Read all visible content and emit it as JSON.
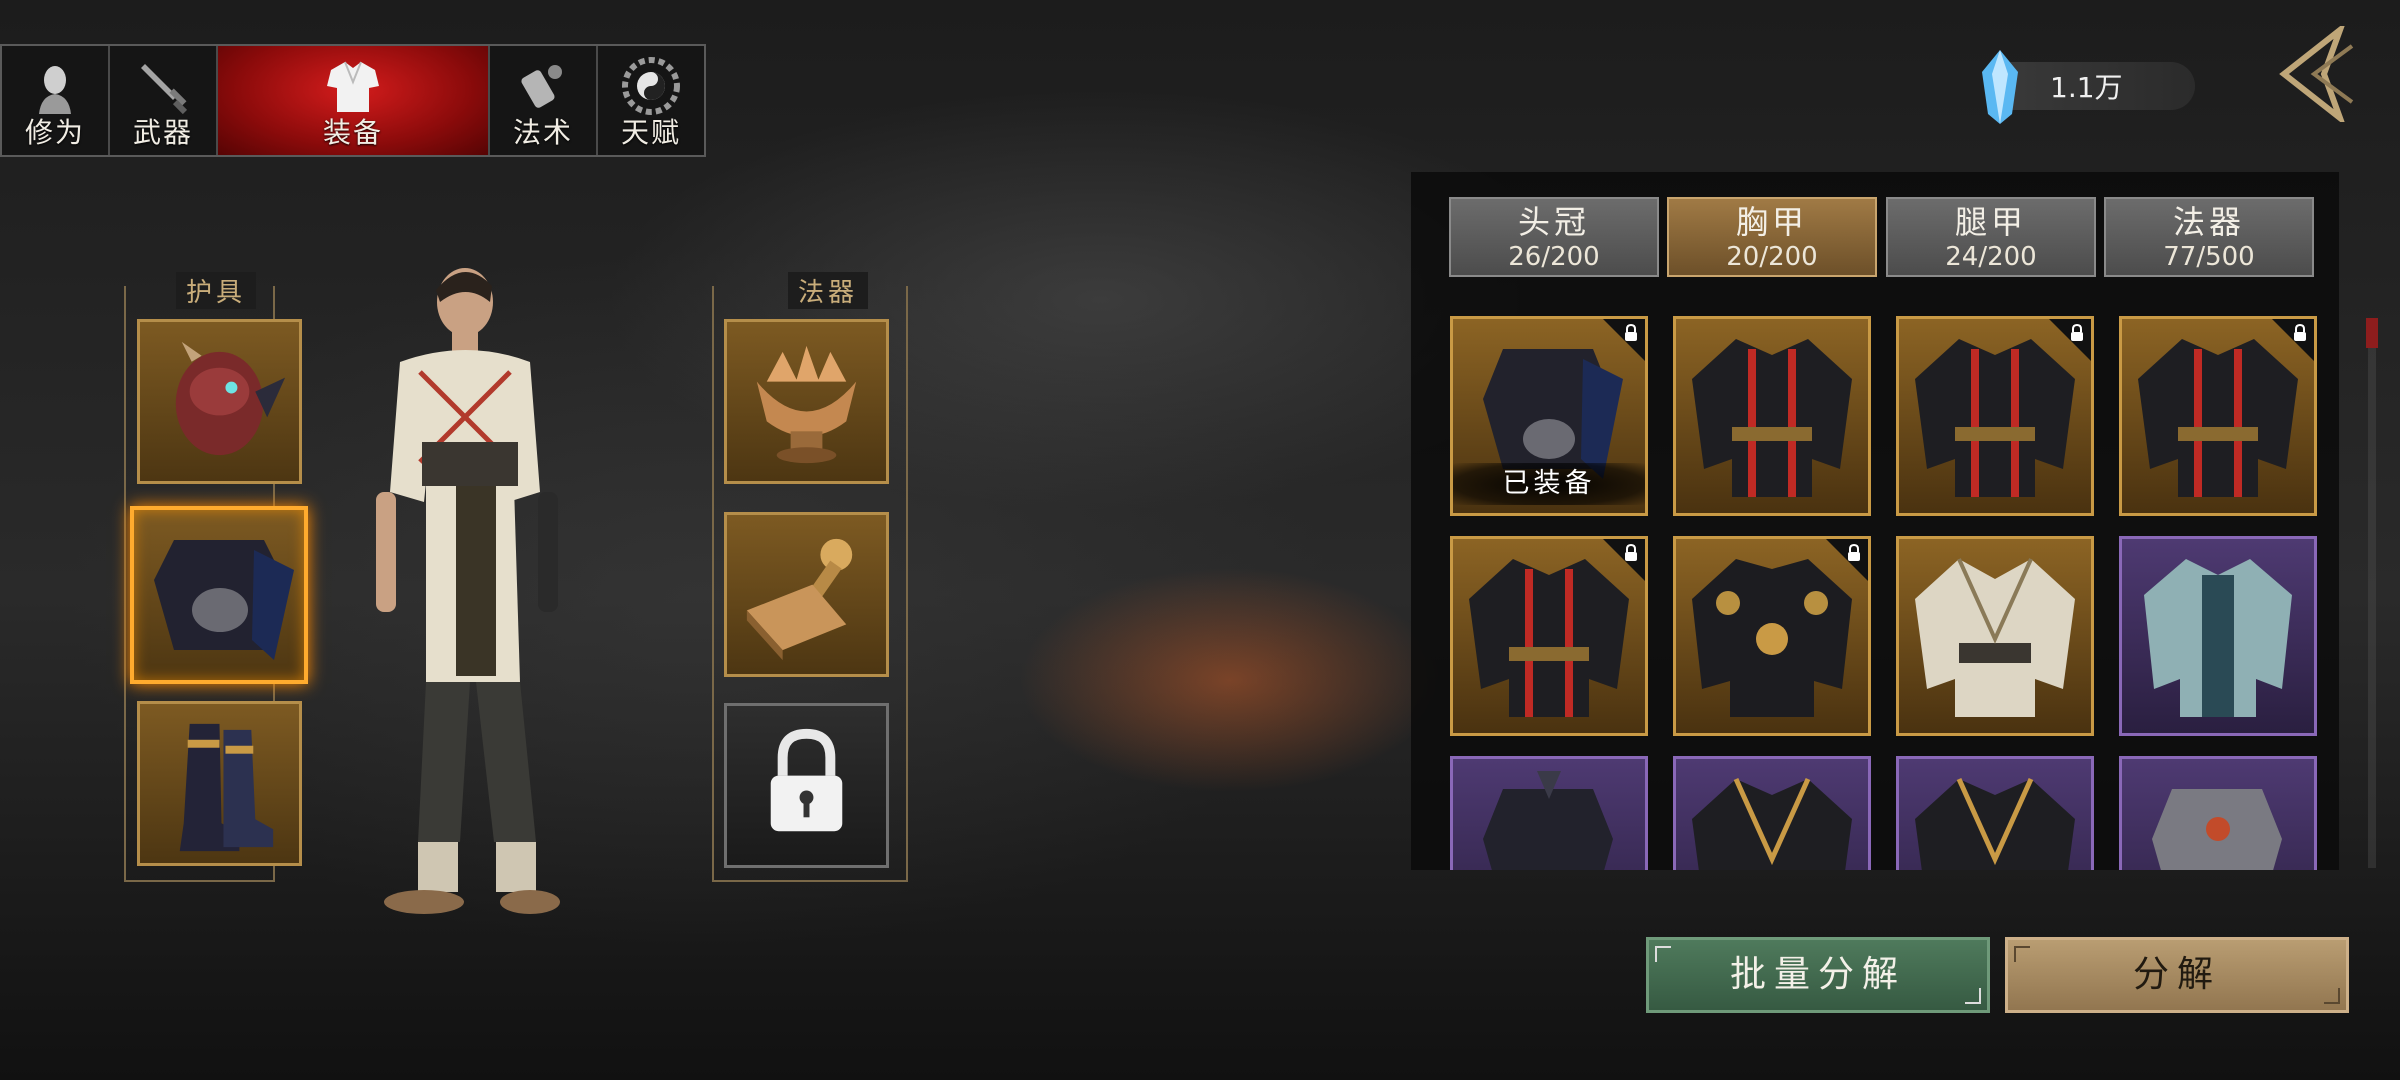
{
  "top_tabs": [
    {
      "label": "修为",
      "icon": "cultivator-head-icon"
    },
    {
      "label": "武器",
      "icon": "sword-hilt-icon"
    },
    {
      "label": "装备",
      "icon": "robe-icon",
      "active": true
    },
    {
      "label": "法术",
      "icon": "scroll-icon"
    },
    {
      "label": "天赋",
      "icon": "bagua-icon"
    }
  ],
  "currency": {
    "value": "1.1万",
    "icon": "blue-crystal-icon"
  },
  "left_groups": {
    "armor_title": "护具",
    "artifact_title": "法器"
  },
  "category_tabs": [
    {
      "name": "头冠",
      "count": "26/200"
    },
    {
      "name": "胸甲",
      "count": "20/200",
      "active": true
    },
    {
      "name": "腿甲",
      "count": "24/200"
    },
    {
      "name": "法器",
      "count": "77/500"
    }
  ],
  "items": [
    {
      "rarity": "gold",
      "locked": true,
      "equipped": true,
      "equipped_label": "已装备",
      "icon": "dark-armor-icon"
    },
    {
      "rarity": "gold",
      "locked": false,
      "icon": "black-red-robe-icon"
    },
    {
      "rarity": "gold",
      "locked": true,
      "icon": "black-red-robe-icon"
    },
    {
      "rarity": "gold",
      "locked": true,
      "icon": "black-red-robe-icon"
    },
    {
      "rarity": "gold",
      "locked": true,
      "icon": "black-red-robe-icon"
    },
    {
      "rarity": "gold",
      "locked": true,
      "icon": "black-gold-jacket-icon"
    },
    {
      "rarity": "gold",
      "locked": false,
      "icon": "white-robe-icon"
    },
    {
      "rarity": "purple",
      "locked": false,
      "icon": "teal-robe-icon"
    },
    {
      "rarity": "purple",
      "locked": false,
      "icon": "dark-armor-icon"
    },
    {
      "rarity": "purple",
      "locked": false,
      "icon": "black-gold-robe-icon"
    },
    {
      "rarity": "purple",
      "locked": false,
      "icon": "black-gold-robe-icon"
    },
    {
      "rarity": "purple",
      "locked": false,
      "icon": "steel-armor-icon"
    }
  ],
  "buttons": {
    "batch_decompose": "批量分解",
    "decompose": "分解"
  },
  "colors": {
    "active_tab_red": "#c41414",
    "gold_rarity": "#c99a45",
    "purple_rarity": "#8a68b8",
    "selected_glow": "#ffab2e",
    "button_green": "#4f7a5c",
    "button_tan": "#b99d72"
  }
}
